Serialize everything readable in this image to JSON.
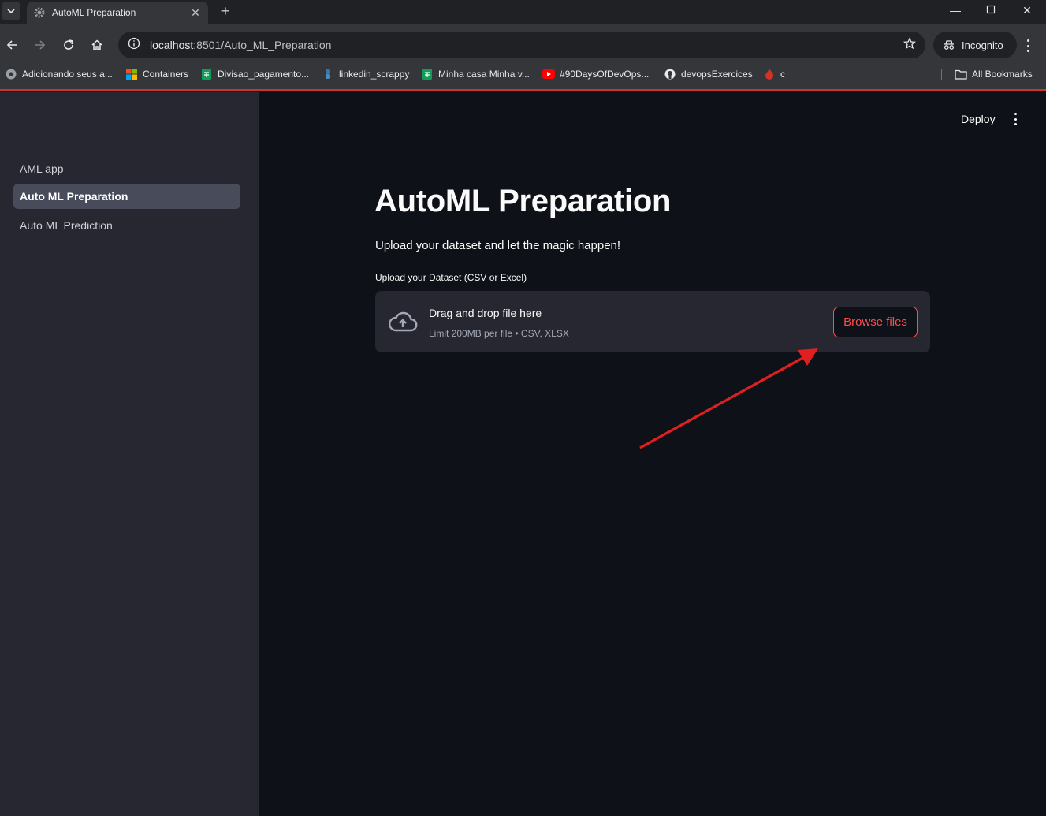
{
  "browser": {
    "tab_title": "AutoML Preparation",
    "url_host": "localhost",
    "url_rest": ":8501/Auto_ML_Preparation",
    "incognito_label": "Incognito",
    "bookmarks": [
      {
        "label": "Adicionando seus a...",
        "icon": "chrome-icon"
      },
      {
        "label": "Containers",
        "icon": "microsoft-icon"
      },
      {
        "label": "Divisao_pagamento...",
        "icon": "sheets-icon"
      },
      {
        "label": "linkedin_scrappy",
        "icon": "python-icon"
      },
      {
        "label": "Minha casa Minha v...",
        "icon": "sheets-icon"
      },
      {
        "label": "#90DaysOfDevOps...",
        "icon": "youtube-icon"
      },
      {
        "label": "devopsExercices",
        "icon": "github-icon"
      },
      {
        "label": "c",
        "icon": "fire-icon"
      }
    ],
    "all_bookmarks_label": "All Bookmarks"
  },
  "sidebar": {
    "items": [
      {
        "label": "AML app",
        "active": false
      },
      {
        "label": "Auto ML Preparation",
        "active": true
      },
      {
        "label": "Auto ML Prediction",
        "active": false
      }
    ]
  },
  "header": {
    "deploy_label": "Deploy"
  },
  "main": {
    "title": "AutoML Preparation",
    "subtitle": "Upload your dataset and let the magic happen!",
    "uploader": {
      "label": "Upload your Dataset (CSV or Excel)",
      "drop_text": "Drag and drop file here",
      "limit_text": "Limit 200MB per file • CSV, XLSX",
      "button_label": "Browse files"
    }
  },
  "colors": {
    "accent": "#ff4b4b",
    "sidebar_bg": "#262730",
    "main_bg": "#0e1117",
    "annotation_arrow": "#e02020"
  }
}
